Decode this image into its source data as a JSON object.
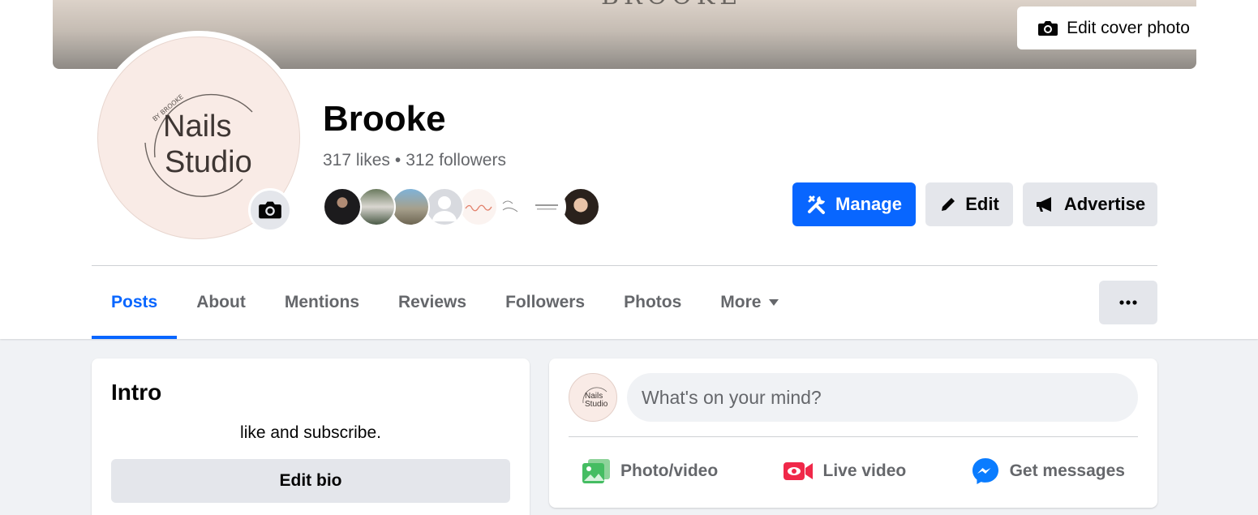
{
  "cover": {
    "brand_text": "BROOKE",
    "edit_label": "Edit cover photo"
  },
  "profile": {
    "logo_small_text": "BY BROOKE",
    "logo_line1": "Nails",
    "logo_line2": "Studio",
    "name": "Brooke",
    "likes": "317 likes",
    "separator": "•",
    "followers": "312 followers"
  },
  "actions": {
    "manage": "Manage",
    "edit": "Edit",
    "advertise": "Advertise"
  },
  "tabs": [
    {
      "label": "Posts",
      "active": true
    },
    {
      "label": "About"
    },
    {
      "label": "Mentions"
    },
    {
      "label": "Reviews"
    },
    {
      "label": "Followers"
    },
    {
      "label": "Photos"
    },
    {
      "label": "More"
    }
  ],
  "intro": {
    "title": "Intro",
    "bio": "like and subscribe.",
    "edit_bio": "Edit bio"
  },
  "composer": {
    "placeholder": "What's on your mind?",
    "photo_video": "Photo/video",
    "live_video": "Live video",
    "get_messages": "Get messages"
  },
  "colors": {
    "primary": "#0866ff",
    "live": "#f02849",
    "photo": "#45bd62",
    "muted": "#65676b",
    "secondary_btn": "#e4e6eb"
  }
}
